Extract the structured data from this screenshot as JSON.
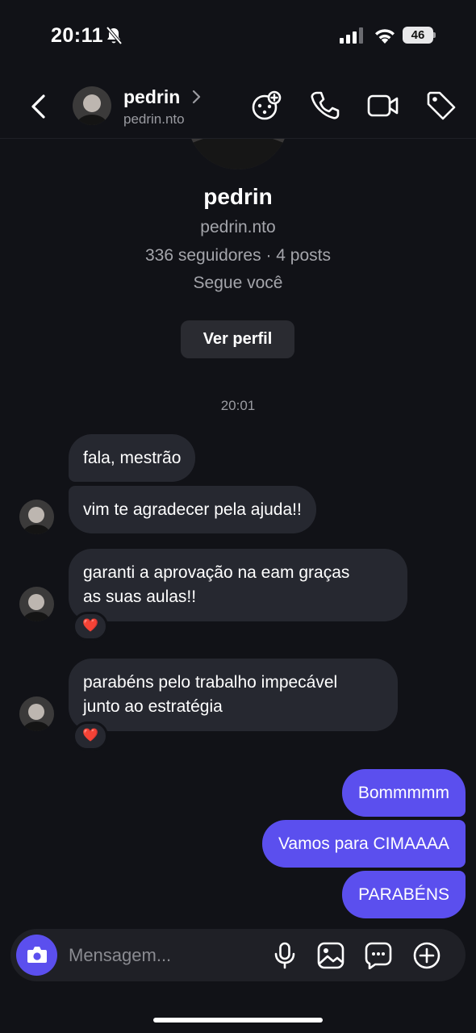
{
  "status_bar": {
    "time": "20:11",
    "battery": "46"
  },
  "header": {
    "name": "pedrin",
    "username": "pedrin.nto"
  },
  "profile": {
    "name": "pedrin",
    "username": "pedrin.nto",
    "stats": "336 seguidores · 4 posts",
    "follows_you": "Segue você",
    "view_profile_label": "Ver perfil"
  },
  "conversation": {
    "timestamp": "20:01",
    "received": [
      {
        "text": "fala, mestrão"
      },
      {
        "text": "vim te agradecer pela ajuda!!"
      },
      {
        "text": "garanti a aprovação na eam graças as suas aulas!!",
        "line1": "garanti a aprovação na eam graças",
        "line2": "as suas aulas!!",
        "reaction": "❤️"
      },
      {
        "text": "parabéns pelo trabalho impecável junto ao estratégia",
        "line1": "parabéns pelo trabalho impecável",
        "line2": "junto ao estratégia",
        "reaction": "❤️"
      }
    ],
    "sent": [
      {
        "text": "Bommmmm"
      },
      {
        "text": "Vamos para CIMAAAA"
      },
      {
        "text": "PARABÉNS"
      }
    ]
  },
  "composer": {
    "placeholder": "Mensagem..."
  },
  "colors": {
    "accent": "#5b4fee",
    "background": "#111217",
    "bubble": "#262830"
  },
  "icons": [
    "bell-slash-icon",
    "signal-icon",
    "wifi-icon",
    "back-chevron-icon",
    "chevron-right-icon",
    "theme-icon",
    "phone-icon",
    "video-icon",
    "tag-icon",
    "camera-icon",
    "microphone-icon",
    "image-icon",
    "sticker-icon",
    "plus-icon"
  ]
}
